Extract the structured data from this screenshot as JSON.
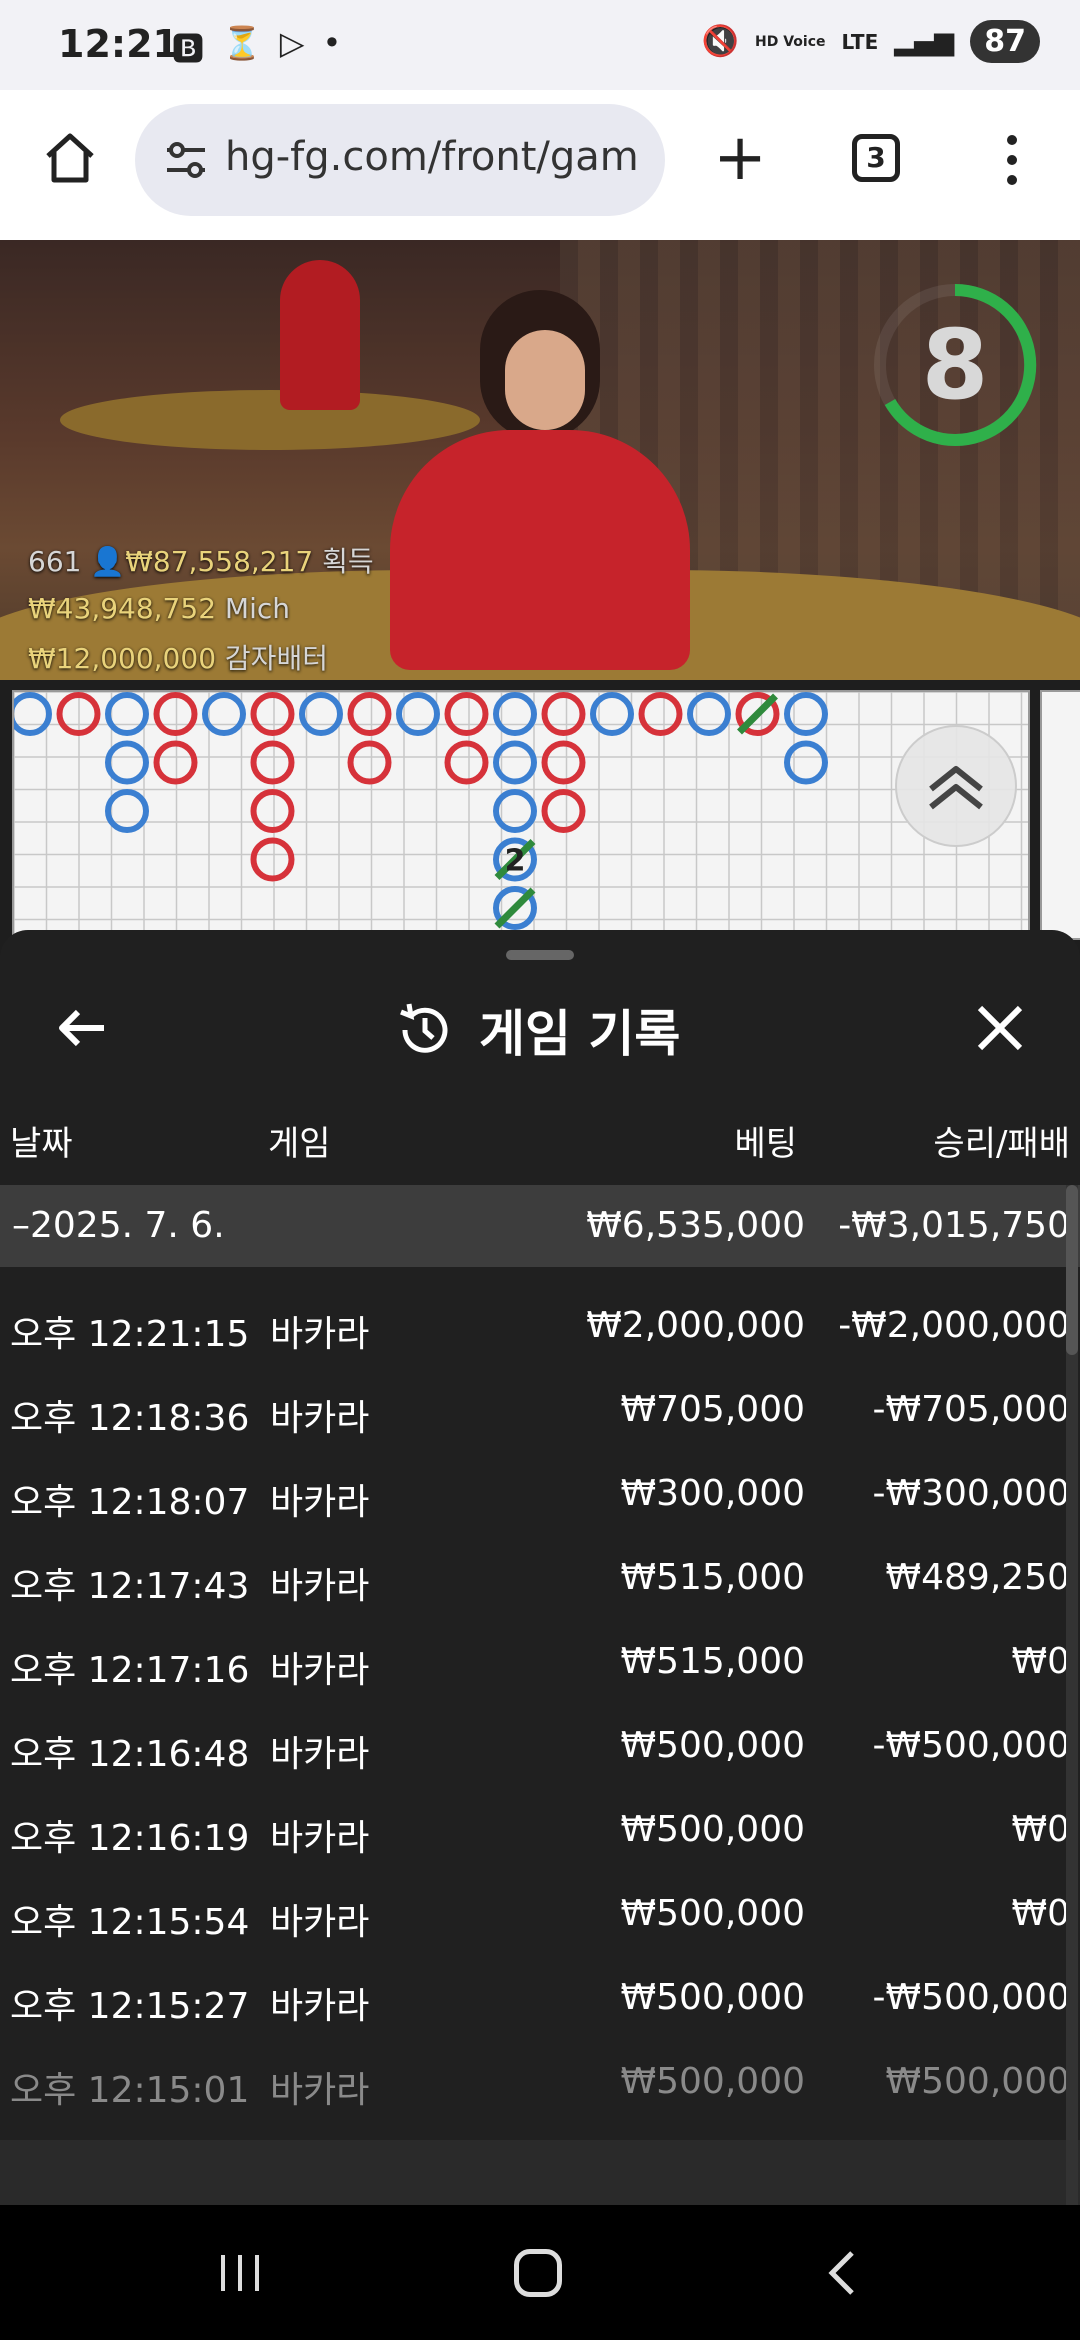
{
  "status": {
    "time": "12:21",
    "icons": [
      "b-icon",
      "timer-icon",
      "play-store-icon",
      "dot"
    ],
    "network": "LTE",
    "hd_voice": "HD Voice",
    "battery": "87"
  },
  "browser": {
    "url": "hg-fg.com/front/gam",
    "tab_count": "3"
  },
  "video": {
    "timer": "8",
    "players_count": "661",
    "total_win": "₩87,558,217",
    "win_label": "획득",
    "big_win_amount": "₩43,948,752",
    "big_win_user": "Mich",
    "third_amount": "₩12,000,000",
    "third_label": "감자배터"
  },
  "history": {
    "title": "게임 기록",
    "columns": {
      "date": "날짜",
      "game": "게임",
      "bet": "베팅",
      "result": "승리/패배"
    },
    "day": {
      "date": "–2025. 7. 6.",
      "bet": "₩6,535,000",
      "result": "-₩3,015,750"
    },
    "rows": [
      {
        "time": "오후 12:21:15",
        "game": "바카라",
        "bet": "₩2,000,000",
        "result": "-₩2,000,000"
      },
      {
        "time": "오후 12:18:36",
        "game": "바카라",
        "bet": "₩705,000",
        "result": "-₩705,000"
      },
      {
        "time": "오후 12:18:07",
        "game": "바카라",
        "bet": "₩300,000",
        "result": "-₩300,000"
      },
      {
        "time": "오후 12:17:43",
        "game": "바카라",
        "bet": "₩515,000",
        "result": "₩489,250"
      },
      {
        "time": "오후 12:17:16",
        "game": "바카라",
        "bet": "₩515,000",
        "result": "₩0"
      },
      {
        "time": "오후 12:16:48",
        "game": "바카라",
        "bet": "₩500,000",
        "result": "-₩500,000"
      },
      {
        "time": "오후 12:16:19",
        "game": "바카라",
        "bet": "₩500,000",
        "result": "₩0"
      },
      {
        "time": "오후 12:15:54",
        "game": "바카라",
        "bet": "₩500,000",
        "result": "₩0"
      },
      {
        "time": "오후 12:15:27",
        "game": "바카라",
        "bet": "₩500,000",
        "result": "-₩500,000"
      },
      {
        "time": "오후 12:15:01",
        "game": "바카라",
        "bet": "₩500,000",
        "result": "₩500,000"
      }
    ]
  },
  "road": {
    "player_color": "#3b7fd1",
    "banker_color": "#d6323a",
    "tie_color": "#2f8a3c",
    "tie_label": "2",
    "columns": [
      [
        "P"
      ],
      [
        "B"
      ],
      [
        "P",
        "P",
        "P"
      ],
      [
        "B",
        "B"
      ],
      [
        "P"
      ],
      [
        "B",
        "B",
        "B",
        "B"
      ],
      [
        "P"
      ],
      [
        "B",
        "B"
      ],
      [
        "P"
      ],
      [
        "B",
        "B"
      ],
      [
        "P",
        "P",
        "P",
        "P",
        "P"
      ],
      [
        "B",
        "B",
        "B"
      ],
      [
        "P"
      ],
      [
        "B"
      ],
      [
        "P"
      ],
      [
        "B"
      ],
      [
        "P",
        "P"
      ]
    ]
  }
}
